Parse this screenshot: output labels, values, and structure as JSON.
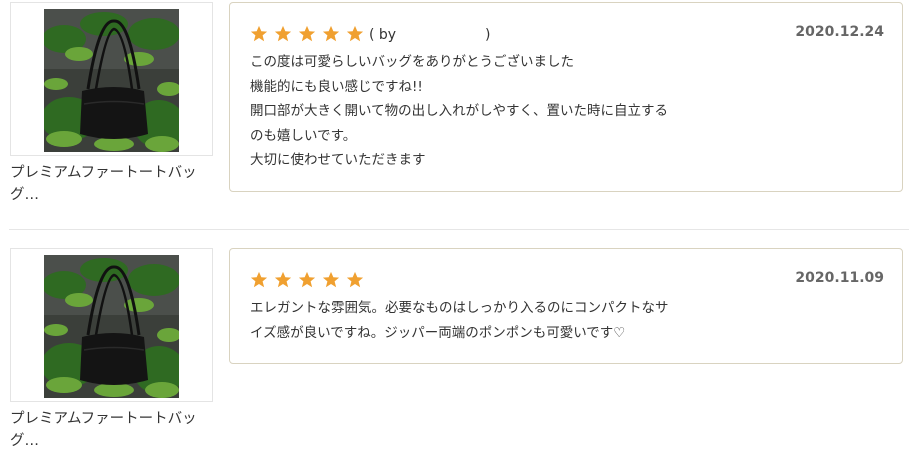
{
  "colors": {
    "star": "#f0a030",
    "card_border": "#d9d3c0",
    "date": "#666666"
  },
  "reviews": [
    {
      "product_name": "プレミアムファートートバッグ…",
      "rating": 5,
      "byline_prefix": "( by",
      "byline_suffix": ")",
      "date": "2020.12.24",
      "lines": [
        "この度は可愛らしいバッグをありがとうございました",
        "機能的にも良い感じですね!!",
        "開口部が大きく開いて物の出し入れがしやすく、置いた時に自立する",
        "のも嬉しいです。",
        "大切に使わせていただきます"
      ]
    },
    {
      "product_name": "プレミアムファートートバッグ…",
      "rating": 5,
      "date": "2020.11.09",
      "lines": [
        "エレガントな雰囲気。必要なものはしっかり入るのにコンパクトなサ",
        "イズ感が良いですね。ジッパー両端のポンポンも可愛いです♡"
      ]
    }
  ]
}
